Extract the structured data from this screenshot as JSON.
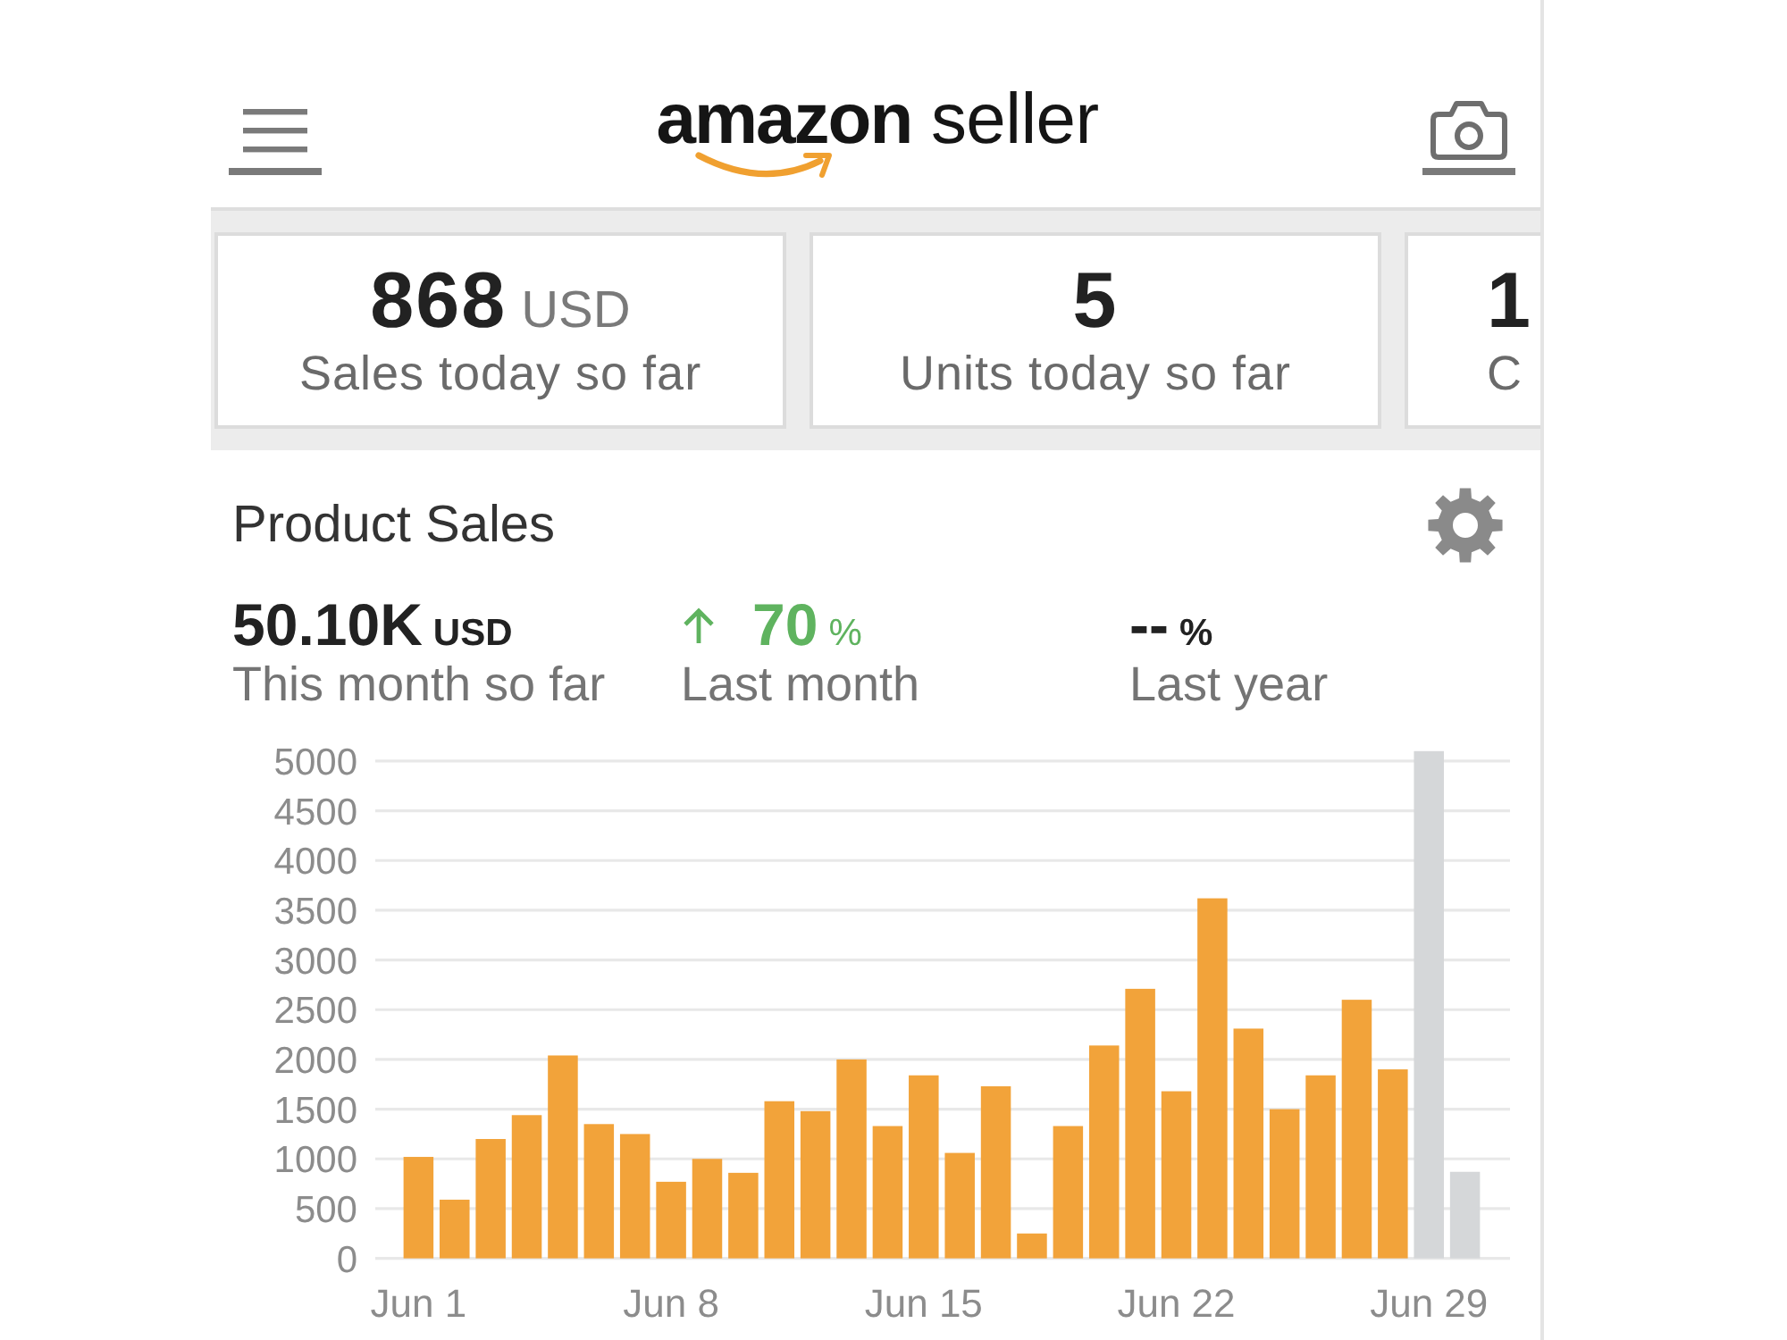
{
  "header": {
    "logo": "**amazon** seller"
  },
  "summary_cards": [
    {
      "value": "868",
      "unit": "USD",
      "label": "Sales today so far",
      "clipped": false
    },
    {
      "value": "5",
      "label": "Units today so far",
      "clipped": false
    },
    {
      "value": "1",
      "label": "C",
      "clipped": true
    }
  ],
  "product_sales": {
    "title": "Product Sales",
    "stats": [
      {
        "value": "50.10K",
        "unit": "USD",
        "label": "This month so far",
        "up": false
      },
      {
        "value": "70",
        "unit": "%",
        "label": "Last month",
        "up": true
      },
      {
        "value": "--",
        "unit": "%",
        "label": "Last year",
        "up": false
      }
    ],
    "chart_data": {
      "type": "bar",
      "categories": [
        "Jun 1",
        null,
        null,
        null,
        null,
        null,
        null,
        "Jun 8",
        null,
        null,
        null,
        null,
        null,
        null,
        "Jun 15",
        null,
        null,
        null,
        null,
        null,
        null,
        "Jun 22",
        null,
        null,
        null,
        null,
        null,
        null,
        "Jun 29",
        null
      ],
      "ylim": [
        0,
        5100
      ],
      "yticks": [
        0,
        500,
        1000,
        1500,
        2000,
        2500,
        3000,
        3500,
        4000,
        4500,
        5000
      ],
      "grid": true,
      "series": [
        {
          "color": "#f2a33a",
          "values": [
            1020,
            590,
            1200,
            1440,
            2040,
            1350,
            1250,
            770,
            1000,
            860,
            1580,
            1480,
            2000,
            1330,
            1840,
            1060,
            1730,
            250,
            1330,
            2140,
            2710,
            1680,
            3620,
            2310,
            1500,
            1840,
            2600,
            1900,
            null,
            null
          ]
        },
        {
          "color": "#d5d7d9",
          "values": [
            null,
            null,
            null,
            null,
            null,
            null,
            null,
            null,
            null,
            null,
            null,
            null,
            null,
            null,
            null,
            null,
            null,
            null,
            null,
            null,
            null,
            null,
            null,
            null,
            null,
            null,
            null,
            null,
            5100,
            870
          ]
        }
      ]
    }
  }
}
